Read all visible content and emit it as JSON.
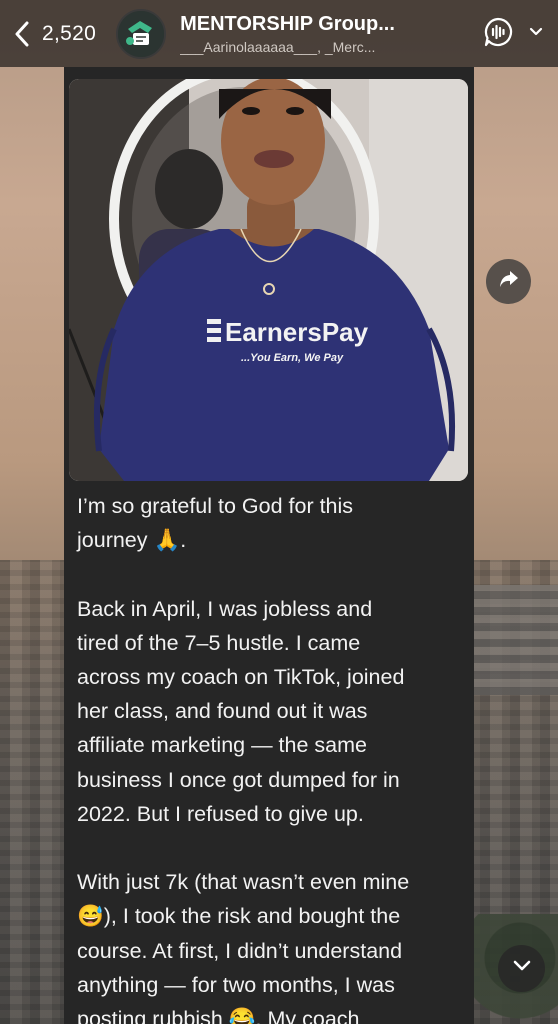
{
  "header": {
    "unread_count": "2,520",
    "title": "MENTORSHIP Group...",
    "subtitle": "___Aarinolaaaaaa___, _Merc..."
  },
  "message": {
    "photo_alt": "",
    "shirt_brand": "EarnersPay",
    "shirt_tagline": "...You Earn, We Pay",
    "caption": "I’m so grateful to God for this\njourney 🙏.\n\nBack in April, I was jobless and\ntired of the 7–5 hustle. I came\nacross my coach on TikTok, joined\nher class, and found out it was\naffiliate marketing — the same\nbusiness I once got dumped for in\n2022. But I refused to give up.\n\nWith just 7k (that wasn’t even mine\n😅), I took the risk and bought the\ncourse. At first, I didn’t understand\nanything — for two months, I was\nposting rubbish 😂. My coach"
  },
  "icons": {
    "back": "chevron-left-icon",
    "call": "voice-chat-icon",
    "share": "share-arrow-icon",
    "scroll": "chevron-down-icon"
  },
  "colors": {
    "bubble": "#262626",
    "header": "#322c28",
    "shirt": "#2e3275"
  }
}
